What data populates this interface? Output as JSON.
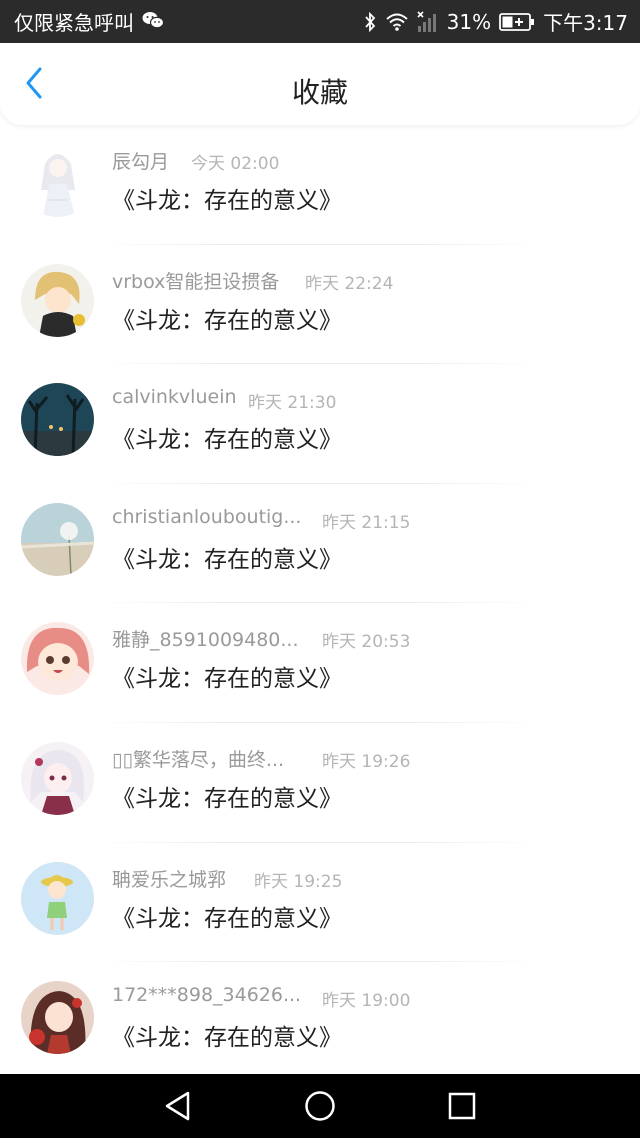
{
  "status_bar": {
    "carrier_text": "仅限紧急呼叫",
    "battery": "31%",
    "time": "下午3:17",
    "icons": [
      "wechat-icon",
      "bluetooth-icon",
      "wifi-icon",
      "signal-icon",
      "battery-icon"
    ]
  },
  "header": {
    "title": "收藏",
    "back_icon": "chevron-left-icon",
    "accent_color": "#2196f3"
  },
  "favorites": [
    {
      "name": "辰勾月",
      "time": "今天 02:00",
      "title": "《斗龙：存在的意义》",
      "avatar": "anime-white-dress-avatar"
    },
    {
      "name": "vrbox智能担设掼备",
      "time": "昨天 22:24",
      "title": "《斗龙：存在的意义》",
      "avatar": "anime-blonde-boy-avatar"
    },
    {
      "name": "calvinkvluein",
      "time": "昨天 21:30",
      "title": "《斗龙：存在的意义》",
      "avatar": "night-street-avatar"
    },
    {
      "name": "christianlouboutig...",
      "time": "昨天 21:15",
      "title": "《斗龙：存在的意义》",
      "avatar": "dandelion-beach-avatar"
    },
    {
      "name": "雅静_8591009480...",
      "time": "昨天 20:53",
      "title": "《斗龙：存在的意义》",
      "avatar": "anime-pink-hair-avatar"
    },
    {
      "name": "▯▯繁华落尽，曲终...",
      "time": "昨天 19:26",
      "title": "《斗龙：存在的意义》",
      "avatar": "anime-white-hair-avatar"
    },
    {
      "name": "聃爱乐之城郛",
      "time": "昨天 19:25",
      "title": "《斗龙：存在的意义》",
      "avatar": "cartoon-straw-hat-girl-avatar"
    },
    {
      "name": "172***898_34626...",
      "time": "昨天 19:00",
      "title": "《斗龙：存在的意义》",
      "avatar": "anime-red-flower-avatar"
    }
  ],
  "system_nav": [
    "back-triangle-icon",
    "home-circle-icon",
    "recents-square-icon"
  ]
}
